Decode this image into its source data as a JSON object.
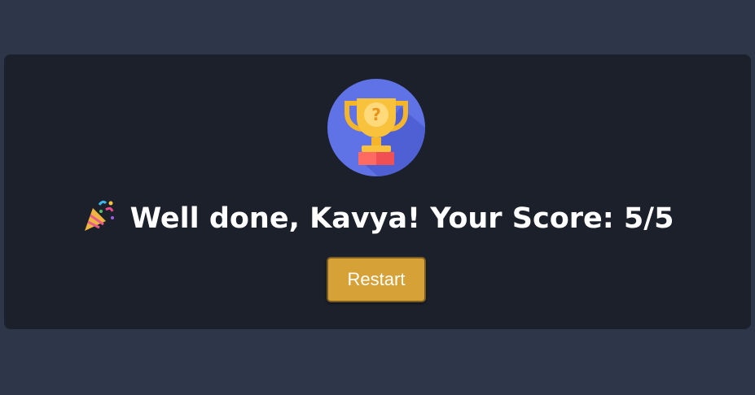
{
  "result": {
    "trophy_icon": "trophy-question-icon",
    "celebration_icon": "party-popper-icon",
    "message": "Well done, Kavya! Your Score: 5/5",
    "restart_label": "Restart"
  },
  "colors": {
    "background": "#2e3649",
    "card": "#1c202b",
    "button": "#d6a136",
    "text": "#ffffff"
  }
}
